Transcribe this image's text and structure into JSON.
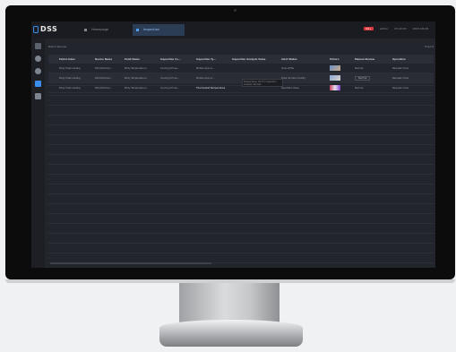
{
  "app": {
    "logo": "DSS"
  },
  "tabs": [
    {
      "label": "Homepage",
      "icon": "home-icon"
    },
    {
      "label": "Inspection",
      "icon": "inspection-icon"
    }
  ],
  "status": {
    "alert_count": "99+",
    "user": "admin",
    "time": "23:40:03",
    "date": "2023-08-08"
  },
  "sidebar": [
    {
      "icon": "grid-icon",
      "color": "#5c626d"
    },
    {
      "icon": "location-icon",
      "color": "#7d8591"
    },
    {
      "icon": "globe-icon",
      "color": "#7d8591"
    },
    {
      "icon": "monitor-icon",
      "color": "#3b8ef0"
    },
    {
      "icon": "report-icon",
      "color": "#7d8591"
    }
  ],
  "toolbar": {
    "title": "Batch Review",
    "export": "Export"
  },
  "table": {
    "headers": [
      "",
      "Patrol Index",
      "Device Name",
      "Point Name",
      "Inspection Co...",
      "Inspection Ty...",
      "Inspection Analysis Value",
      "Alert Status",
      "Picture",
      "Manual Review",
      "Operation"
    ],
    "rows": [
      [
        "",
        "Body Heat Lasting",
        "Pdm/Outdoor...",
        "Body Temperature...",
        "Cooling Of Lev...",
        "Mobile App Lo...",
        "",
        "Over-alFfer",
        "",
        "Normal",
        "Request more"
      ],
      [
        "",
        "Body Heat Lasting",
        "Pdm/Outdoor...",
        "Body Temperature...",
        "Cooling Of Lev...",
        "Mobile App Lo...",
        "",
        "Data Ab Abnormality",
        "",
        "Normal",
        "Request more"
      ],
      [
        "",
        "Body Heat Lasting",
        "Pdm/Outdoor...",
        "Body Temperature...",
        "Cooling Of Lev...",
        "Thermostat Temperature",
        "",
        "Specified Value",
        "",
        "Normal",
        "Request more"
      ]
    ],
    "tooltip": "Temperature: 36.5°C  Inspection Analysis: Normal"
  }
}
